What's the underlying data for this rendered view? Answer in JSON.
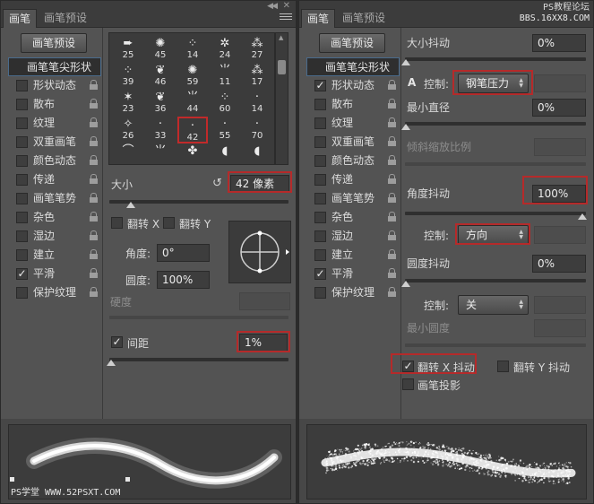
{
  "left_panel": {
    "tabs": [
      "画笔",
      "画笔预设"
    ],
    "preset_button": "画笔预设",
    "options": [
      {
        "label": "画笔笔尖形状",
        "header": true
      },
      {
        "label": "形状动态",
        "checked": false
      },
      {
        "label": "散布",
        "checked": false
      },
      {
        "label": "纹理",
        "checked": false
      },
      {
        "label": "双重画笔",
        "checked": false
      },
      {
        "label": "颜色动态",
        "checked": false
      },
      {
        "label": "传递",
        "checked": false
      },
      {
        "label": "画笔笔势",
        "checked": false
      },
      {
        "label": "杂色",
        "checked": false
      },
      {
        "label": "湿边",
        "checked": false
      },
      {
        "label": "建立",
        "checked": false
      },
      {
        "label": "平滑",
        "checked": true
      },
      {
        "label": "保护纹理",
        "checked": false
      }
    ],
    "brush_tips": [
      {
        "size": "25",
        "icon": "arrow-brush"
      },
      {
        "size": "45",
        "icon": "splatter-brush"
      },
      {
        "size": "14",
        "icon": "dots-brush"
      },
      {
        "size": "24",
        "icon": "scatter-brush"
      },
      {
        "size": "27",
        "icon": "spray-brush"
      },
      {
        "size": "39",
        "icon": "dots-brush"
      },
      {
        "size": "46",
        "icon": "leaf-brush"
      },
      {
        "size": "59",
        "icon": "splatter-brush"
      },
      {
        "size": "11",
        "icon": "grass-brush"
      },
      {
        "size": "17",
        "icon": "spray-brush"
      },
      {
        "size": "23",
        "icon": "star-brush"
      },
      {
        "size": "36",
        "icon": "leaf-brush"
      },
      {
        "size": "44",
        "icon": "grass-brush"
      },
      {
        "size": "60",
        "icon": "dots-brush"
      },
      {
        "size": "14",
        "icon": "dot-brush"
      },
      {
        "size": "26",
        "icon": "spark-brush"
      },
      {
        "size": "33",
        "icon": "dot-brush"
      },
      {
        "size": "42",
        "icon": "dot-brush",
        "selected": true
      },
      {
        "size": "55",
        "icon": "dot-brush"
      },
      {
        "size": "70",
        "icon": "dot-brush"
      },
      {
        "size": "",
        "icon": "stroke-brush"
      },
      {
        "size": "",
        "icon": "grass-brush"
      },
      {
        "size": "",
        "icon": "maple-leaf-brush"
      },
      {
        "size": "",
        "icon": "round-brush"
      },
      {
        "size": "",
        "icon": "round-brush"
      }
    ],
    "size_label": "大小",
    "size_value": "42 像素",
    "size_slider": 0.12,
    "flip_x_label": "翻转 X",
    "flip_y_label": "翻转 Y",
    "angle_label": "角度:",
    "angle_value": "0°",
    "roundness_label": "圆度:",
    "roundness_value": "100%",
    "hardness_label": "硬度",
    "spacing_label": "间距",
    "spacing_checked": true,
    "spacing_value": "1%",
    "spacing_slider": 0.01,
    "watermark_bottom": "PS学堂 WWW.52PSXT.COM"
  },
  "right_panel": {
    "tabs": [
      "画笔",
      "画笔预设"
    ],
    "watermark_top": [
      "PS教程论坛",
      "BBS.16XX8.COM"
    ],
    "preset_button": "画笔预设",
    "options": [
      {
        "label": "画笔笔尖形状",
        "header": true
      },
      {
        "label": "形状动态",
        "checked": true
      },
      {
        "label": "散布",
        "checked": false
      },
      {
        "label": "纹理",
        "checked": false
      },
      {
        "label": "双重画笔",
        "checked": false
      },
      {
        "label": "颜色动态",
        "checked": false
      },
      {
        "label": "传递",
        "checked": false
      },
      {
        "label": "画笔笔势",
        "checked": false
      },
      {
        "label": "杂色",
        "checked": false
      },
      {
        "label": "湿边",
        "checked": false
      },
      {
        "label": "建立",
        "checked": false
      },
      {
        "label": "平滑",
        "checked": true
      },
      {
        "label": "保护纹理",
        "checked": false
      }
    ],
    "size_jitter_label": "大小抖动",
    "size_jitter_value": "0%",
    "control_label": "控制:",
    "control_value_1": "钢笔压力",
    "min_diameter_label": "最小直径",
    "min_diameter_value": "0%",
    "tilt_scale_label": "倾斜缩放比例",
    "angle_jitter_label": "角度抖动",
    "angle_jitter_value": "100%",
    "control_value_2": "方向",
    "roundness_jitter_label": "圆度抖动",
    "roundness_jitter_value": "0%",
    "control_value_3": "关",
    "min_roundness_label": "最小圆度",
    "flip_x_jitter_label": "翻转 X 抖动",
    "flip_x_jitter_checked": true,
    "flip_y_jitter_label": "翻转 Y 抖动",
    "flip_y_jitter_checked": false,
    "brush_projection_label": "画笔投影",
    "brush_projection_checked": false
  }
}
